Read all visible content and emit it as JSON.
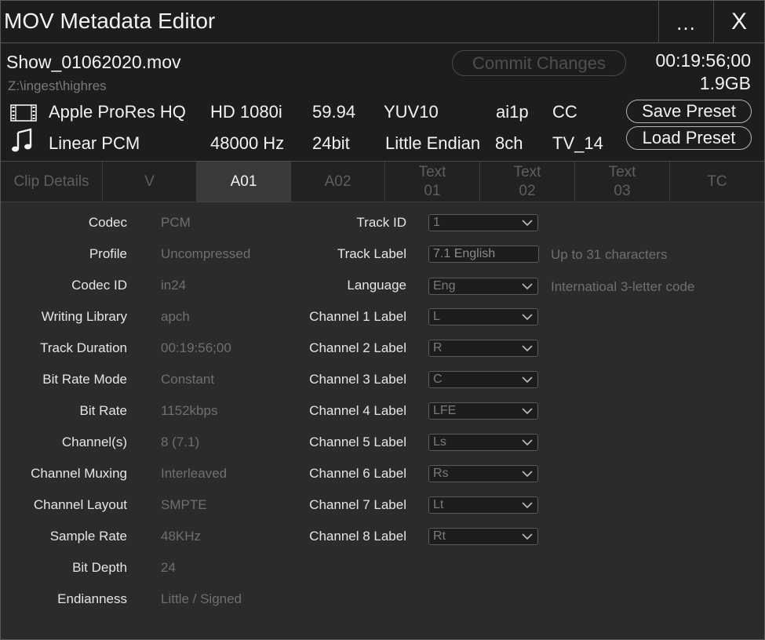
{
  "window": {
    "title": "MOV Metadata Editor",
    "more_label": "...",
    "close_label": "X"
  },
  "file": {
    "name": "Show_01062020.mov",
    "path": "Z:\\ingest\\highres",
    "duration": "00:19:56;00",
    "size": "1.9GB",
    "commit_label": "Commit Changes"
  },
  "video_info": {
    "icon": "film-icon",
    "codec": "Apple ProRes HQ",
    "format": "HD 1080i",
    "framerate": "59.94",
    "colorspace": "YUV10",
    "scan": "ai1p",
    "cc": "CC"
  },
  "audio_info": {
    "icon": "music-note-icon",
    "codec": "Linear PCM",
    "sample_rate": "48000 Hz",
    "bit_depth": "24bit",
    "endian": "Little Endian",
    "channels": "8ch",
    "rating": "TV_14"
  },
  "presets": {
    "save_label": "Save Preset",
    "load_label": "Load Preset"
  },
  "tabs": [
    {
      "label": "Clip Details"
    },
    {
      "label": "V"
    },
    {
      "label": "A01"
    },
    {
      "label": "A02"
    },
    {
      "label_line1": "Text",
      "label_line2": "01"
    },
    {
      "label_line1": "Text",
      "label_line2": "02"
    },
    {
      "label_line1": "Text",
      "label_line2": "03"
    },
    {
      "label": "TC"
    }
  ],
  "details": [
    {
      "label": "Codec",
      "value": "PCM"
    },
    {
      "label": "Profile",
      "value": "Uncompressed"
    },
    {
      "label": "Codec ID",
      "value": "in24"
    },
    {
      "label": "Writing Library",
      "value": "apch"
    },
    {
      "label": "Track Duration",
      "value": "00:19:56;00"
    },
    {
      "label": "Bit Rate Mode",
      "value": "Constant"
    },
    {
      "label": "Bit Rate",
      "value": "1152kbps"
    },
    {
      "label": "Channel(s)",
      "value": "8 (7.1)"
    },
    {
      "label": "Channel Muxing",
      "value": "Interleaved"
    },
    {
      "label": "Channel Layout",
      "value": "SMPTE"
    },
    {
      "label": "Sample Rate",
      "value": "48KHz"
    },
    {
      "label": "Bit Depth",
      "value": "24"
    },
    {
      "label": "Endianness",
      "value": "Little / Signed"
    }
  ],
  "track_fields": {
    "track_id": {
      "label": "Track ID",
      "value": "1"
    },
    "track_label": {
      "label": "Track Label",
      "value": "7.1 English",
      "hint": "Up to 31 characters"
    },
    "language": {
      "label": "Language",
      "value": "Eng",
      "hint": "Internatioal 3-letter code"
    },
    "channels": [
      {
        "label": "Channel 1 Label",
        "value": "L"
      },
      {
        "label": "Channel 2 Label",
        "value": "R"
      },
      {
        "label": "Channel 3 Label",
        "value": "C"
      },
      {
        "label": "Channel 4 Label",
        "value": "LFE"
      },
      {
        "label": "Channel 5 Label",
        "value": "Ls"
      },
      {
        "label": "Channel 6 Label",
        "value": "Rs"
      },
      {
        "label": "Channel 7 Label",
        "value": "Lt"
      },
      {
        "label": "Channel 8 Label",
        "value": "Rt"
      }
    ]
  }
}
